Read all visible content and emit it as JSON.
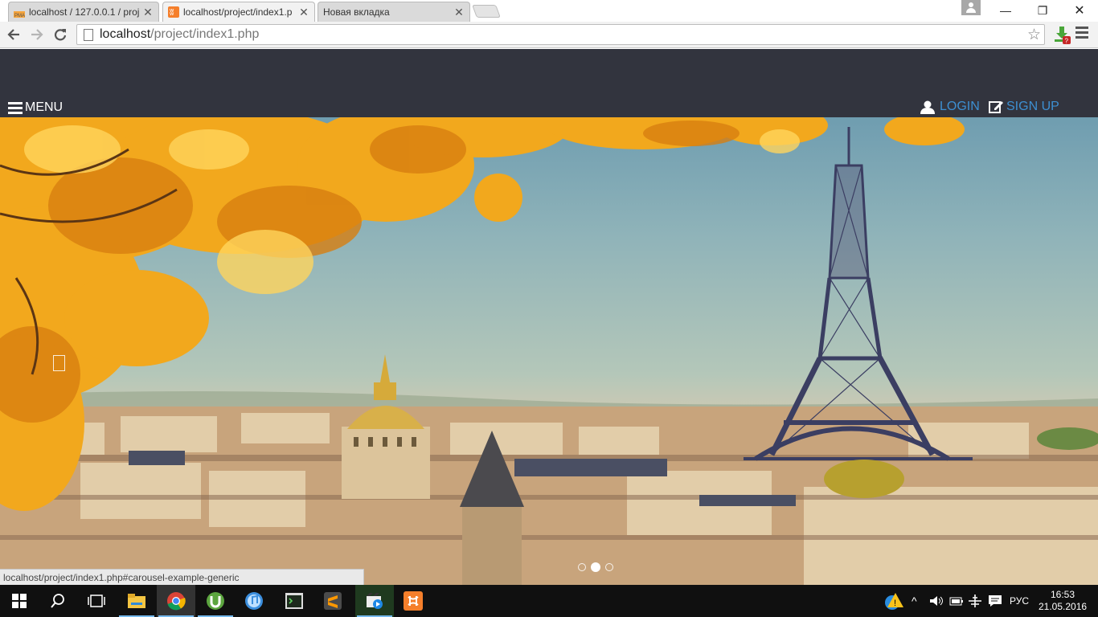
{
  "browser": {
    "tabs": [
      {
        "title": "localhost / 127.0.0.1 / proj",
        "active": false
      },
      {
        "title": "localhost/project/index1.p",
        "active": true
      },
      {
        "title": "Новая вкладка",
        "active": false
      }
    ],
    "url_host": "localhost",
    "url_path": "/project/index1.php"
  },
  "site": {
    "menu_label": "MENU",
    "login_label": "LOGIN",
    "signup_label": "SIGN UP",
    "accent_color": "#3d8fd1",
    "header_color": "#32343e"
  },
  "carousel": {
    "slide_count": 3,
    "active_slide": 2
  },
  "status_bar": {
    "text": "localhost/project/index1.php#carousel-example-generic"
  },
  "taskbar": {
    "language": "РУС",
    "time": "16:53",
    "date": "21.05.2016",
    "apps": [
      "start-icon",
      "search-icon",
      "task-view-icon",
      "file-explorer-icon",
      "chrome-icon",
      "utorrent-icon",
      "itunes-icon",
      "terminal-icon",
      "sublime-text-icon",
      "video-editor-icon",
      "xampp-icon"
    ]
  }
}
